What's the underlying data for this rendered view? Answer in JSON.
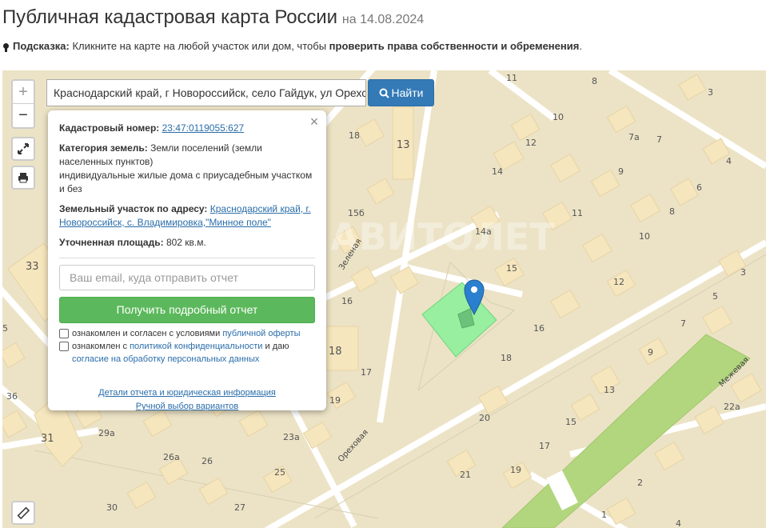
{
  "header": {
    "title": "Публичная кадастровая карта России",
    "date": "на 14.08.2024"
  },
  "hint": {
    "label": "Подсказка:",
    "text": " Кликните на карте на любой участок или дом, чтобы ",
    "bold": "проверить права собственности и обременения",
    "end": "."
  },
  "search": {
    "value": "Краснодарский край, г Новороссийск, село Гайдук, ул Орехс",
    "button_label": "Найти"
  },
  "map_controls": {
    "zoom_in": "+",
    "zoom_out": "−"
  },
  "popup": {
    "close": "×",
    "cadastral_label": "Кадастровый номер:",
    "cadastral_value": "23:47:0119055:627",
    "category_label": "Категория земель:",
    "category_value": "Земли поселений (земли населенных пунктов)",
    "use_value": "индивидуальные жилые дома с приусадебным участком и без",
    "address_label": "Земельный участок по адресу:",
    "address_value": "Краснодарский край, г. Новороссийск, с. Владимировка,\"Минное поле\"",
    "area_label": "Уточненная площадь:",
    "area_value": "802 кв.м.",
    "email_placeholder": "Ваш email, куда отправить отчет",
    "report_button": "Получить подробный отчет",
    "consent1_text": "ознакомлен и согласен с условиями ",
    "consent1_link": "публичной оферты",
    "consent2_text": "ознакомлен с ",
    "consent2_link": "политикой конфиденциальности",
    "consent2_and": " и даю ",
    "consent2_link2": "согласие на обработку персональных данных",
    "details_link": "Детали отчета и юридическая информация",
    "manual_link": "Ручной выбор вариантов"
  },
  "map": {
    "street_labels": [
      "Зеленая",
      "Ореховая",
      "Межевая"
    ],
    "watermark": "АВИТОЛЕТ",
    "house_numbers": [
      "11",
      "8",
      "3",
      "10",
      "12",
      "7а",
      "7",
      "18",
      "13",
      "14",
      "4",
      "9",
      "6",
      "15б",
      "11",
      "8",
      "14а",
      "10",
      "33",
      "15",
      "12",
      "3",
      "16",
      "5",
      "7",
      "16",
      "9",
      "18",
      "17",
      "18",
      "5",
      "36",
      "19",
      "13",
      "15",
      "20",
      "22а",
      "31",
      "29а",
      "23а",
      "17",
      "26а",
      "26",
      "25",
      "21",
      "19",
      "2",
      "30",
      "27",
      "1",
      "4"
    ]
  },
  "colors": {
    "map_background": "#ece3c6",
    "road": "#ffffff",
    "building": "#f6e6bd",
    "parcel": "#8ef09a",
    "park": "#b2d67d",
    "marker": "#2b7fcf",
    "report_button": "#5cb85c",
    "search_button": "#337ab7"
  },
  "icons": {
    "zoom_in": "plus-icon",
    "zoom_out": "minus-icon",
    "fullscreen": "expand-icon",
    "print": "print-icon",
    "ruler": "ruler-icon",
    "search": "search-icon",
    "close": "close-icon",
    "marker": "map-marker-icon",
    "hint": "lightbulb-icon"
  }
}
